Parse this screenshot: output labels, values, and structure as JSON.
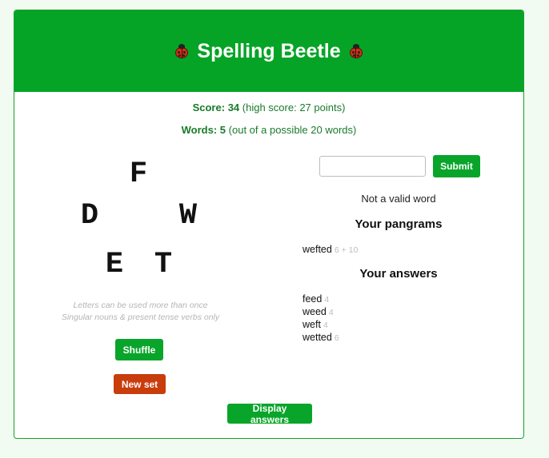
{
  "header": {
    "title": "Spelling Beetle"
  },
  "score": {
    "label": "Score:",
    "value": "34",
    "detail": "(high score: 27 points)"
  },
  "words": {
    "label": "Words:",
    "value": "5",
    "detail": "(out of a possible 20 words)"
  },
  "letters": [
    "F",
    "D",
    "W",
    "E",
    "T"
  ],
  "hints": {
    "line1": "Letters can be used more than once",
    "line2": "Singular nouns & present tense verbs only"
  },
  "buttons": {
    "shuffle": "Shuffle",
    "new_set": "New set",
    "submit": "Submit",
    "display_answers": "Display answers"
  },
  "input": {
    "value": "",
    "placeholder": ""
  },
  "message": "Not a valid word",
  "pangrams": {
    "heading": "Your pangrams",
    "items": [
      {
        "word": "wefted",
        "points": "6 + 10"
      }
    ]
  },
  "answers": {
    "heading": "Your answers",
    "items": [
      {
        "word": "feed",
        "points": "4"
      },
      {
        "word": "weed",
        "points": "4"
      },
      {
        "word": "weft",
        "points": "4"
      },
      {
        "word": "wetted",
        "points": "6"
      }
    ]
  },
  "colors": {
    "header_bg": "#06a426",
    "button_green": "#09a52a",
    "button_red": "#c93c0b",
    "score_text": "#1a7a2c"
  },
  "icons": {
    "title_left": "ladybug-icon",
    "title_right": "ladybug-icon"
  }
}
